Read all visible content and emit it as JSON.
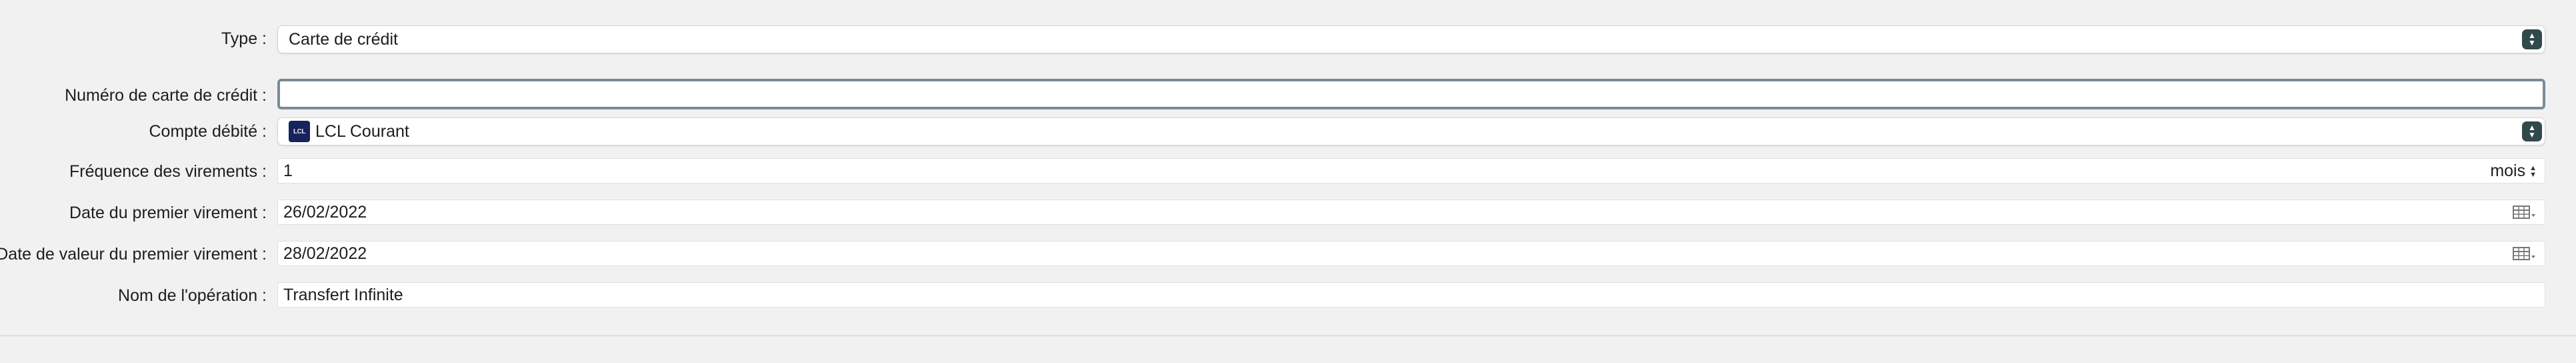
{
  "form": {
    "type": {
      "label": "Type :",
      "value": "Carte de crédit"
    },
    "card_number": {
      "label": "Numéro de carte de crédit :",
      "value": ""
    },
    "debit_account": {
      "label": "Compte débité :",
      "value": "LCL Courant",
      "icon": "LCL"
    },
    "frequency": {
      "label": "Fréquence des virements :",
      "value": "1",
      "unit": "mois"
    },
    "first_transfer_date": {
      "label": "Date du premier virement :",
      "value": "26/02/2022"
    },
    "first_value_date": {
      "label": "Date de valeur du premier virement :",
      "value": "28/02/2022"
    },
    "operation_name": {
      "label": "Nom de l'opération :",
      "value": "Transfert Infinite"
    }
  }
}
